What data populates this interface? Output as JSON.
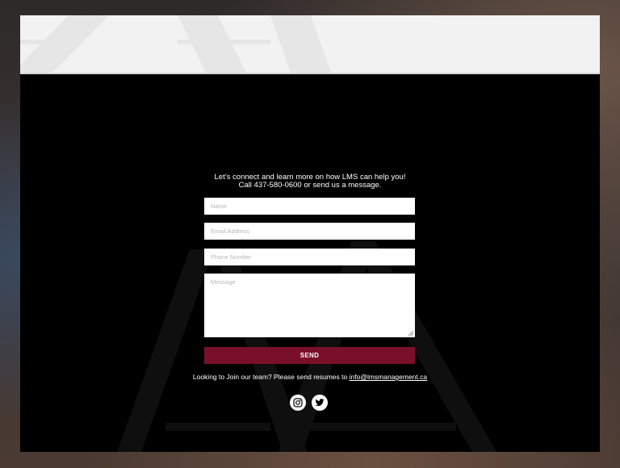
{
  "contact": {
    "intro_line1": "Let’s connect and learn more on how LMS can help you!",
    "intro_line2": "Call 437-580-0600 or send us a message."
  },
  "form": {
    "name_placeholder": "Name",
    "email_placeholder": "Email Address",
    "phone_placeholder": "Phone Number",
    "message_placeholder": "Message",
    "send_label": "SEND"
  },
  "careers": {
    "text": "Looking to Join our team? Please send resumes to ",
    "email": "info@lmsmanagement.ca"
  },
  "social": [
    {
      "icon": "instagram-icon"
    },
    {
      "icon": "twitter-icon"
    }
  ],
  "colors": {
    "accent": "#7a0f2a",
    "panel": "#000000",
    "top_band": "#f2f2f2"
  }
}
